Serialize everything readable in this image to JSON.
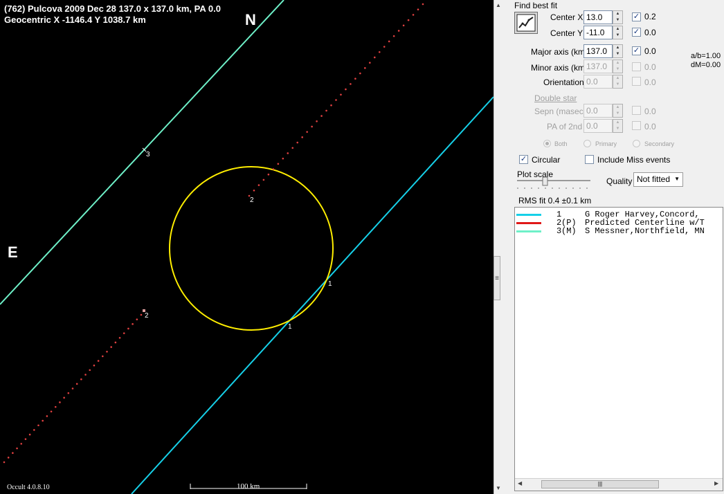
{
  "plot": {
    "title_line1": "(762) Pulcova  2009 Dec 28   137.0 x 137.0 km, PA 0.0",
    "title_line2": "Geocentric  X  -1146.4  Y 1038.7 km",
    "north": "N",
    "east": "E",
    "chord_labels": [
      "3",
      "2",
      "2",
      "1",
      "1"
    ],
    "scale_label": "100 km",
    "version": "Occult 4.0.8.10",
    "colors": {
      "background": "#000000",
      "ellipse": "#ffee00",
      "chord_1": "#16d0e8",
      "chord_3": "#6ef0c8",
      "predicted": "#e04040"
    }
  },
  "panel": {
    "find_best_fit": "Find best fit",
    "fit_icon": "chart-fit-icon",
    "rows": [
      {
        "label": "Center X",
        "value": "13.0",
        "check": true,
        "check_label": "0.2",
        "enabled": true
      },
      {
        "label": "Center Y",
        "value": "-11.0",
        "check": true,
        "check_label": "0.0",
        "enabled": true
      },
      {
        "label": "Major axis (km)",
        "value": "137.0",
        "check": true,
        "check_label": "0.0",
        "enabled": true
      },
      {
        "label": "Minor axis (km)",
        "value": "137.0",
        "check": false,
        "check_label": "0.0",
        "enabled": false
      },
      {
        "label": "Orientation",
        "value": "0.0",
        "check": false,
        "check_label": "0.0",
        "enabled": false
      }
    ],
    "ab_ratio": "a/b=1.00",
    "dm": "dM=0.00",
    "double_star": "Double star",
    "double_rows": [
      {
        "label": "Sepn (masec)",
        "value": "0.0",
        "check_label": "0.0"
      },
      {
        "label": "PA of 2nd",
        "value": "0.0",
        "check_label": "0.0"
      }
    ],
    "radios": [
      "Both",
      "Primary",
      "Secondary"
    ],
    "circular": "Circular",
    "circular_checked": true,
    "include_miss": "Include Miss events",
    "include_miss_checked": false,
    "plot_scale": "Plot scale",
    "quality_label": "Quality",
    "quality_value": "Not fitted",
    "rms_fit": "RMS fit 0.4 ±0.1 km"
  },
  "legend": [
    {
      "index": "1",
      "flag": "",
      "name": "G Roger Harvey,Concord,",
      "color": "#16d0e8"
    },
    {
      "index": "2",
      "flag": "(P)",
      "name": "Predicted Centerline w/T",
      "color": "#e01818"
    },
    {
      "index": "3",
      "flag": "(M)",
      "name": "S Messner,Northfield, MN",
      "color": "#6ef0c8"
    }
  ]
}
